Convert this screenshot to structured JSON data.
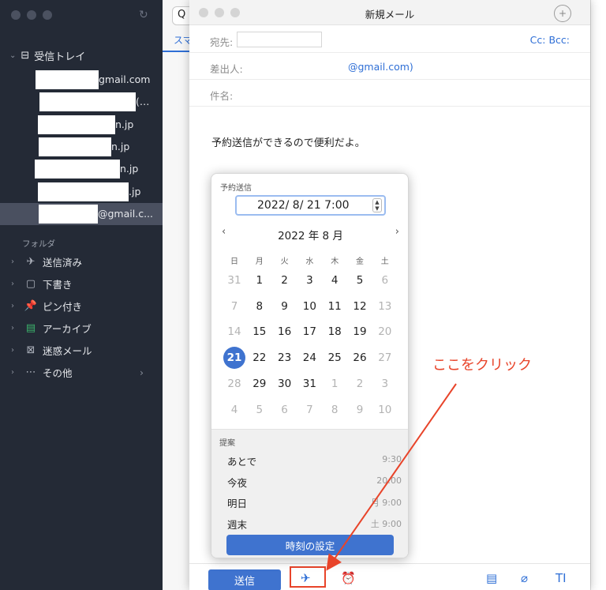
{
  "sidebar": {
    "inbox_label": "受信トレイ",
    "accounts": [
      {
        "text": "gmail.com",
        "mask_w": 80,
        "text_x": 125
      },
      {
        "text": "(…",
        "mask_w": 122,
        "text_x": 172
      },
      {
        "text": "n.jp",
        "mask_w": 98,
        "text_x": 146
      },
      {
        "text": "n.jp",
        "mask_w": 92,
        "text_x": 141
      },
      {
        "text": "n.jp",
        "mask_w": 108,
        "text_x": 152
      },
      {
        "text": ".jp",
        "mask_w": 115,
        "text_x": 163
      },
      {
        "text": "@gmail.c...",
        "mask_w": 75,
        "text_x": 124
      }
    ],
    "folders_title": "フォルダ",
    "folders": [
      {
        "label": "送信済み",
        "icon": "✈"
      },
      {
        "label": "下書き",
        "icon": "▢"
      },
      {
        "label": "ピン付き",
        "icon": "📌"
      },
      {
        "label": "アーカイブ",
        "icon": "▤"
      },
      {
        "label": "迷惑メール",
        "icon": "⊠"
      },
      {
        "label": "その他",
        "icon": "⋯"
      }
    ]
  },
  "list": {
    "search_icon": "Q",
    "tab_label": "スマ"
  },
  "compose": {
    "title": "新規メール",
    "to_label": "宛先:",
    "cc_bcc": "Cc:  Bcc:",
    "from_label": "差出人:",
    "from_value": "@gmail.com)",
    "subject_label": "件名:",
    "body": "予約送信ができるので便利だよ。",
    "send_label": "送信"
  },
  "schedule": {
    "title": "予約送信",
    "datetime": "2022/  8/ 21   7:00",
    "month_label": "2022 年 8 月",
    "prev": "‹",
    "next": "›",
    "weekdays": [
      "日",
      "月",
      "火",
      "水",
      "木",
      "金",
      "土"
    ],
    "weeks": [
      [
        "31",
        "1",
        "2",
        "3",
        "4",
        "5",
        "6"
      ],
      [
        "7",
        "8",
        "9",
        "10",
        "11",
        "12",
        "13"
      ],
      [
        "14",
        "15",
        "16",
        "17",
        "18",
        "19",
        "20"
      ],
      [
        "21",
        "22",
        "23",
        "24",
        "25",
        "26",
        "27"
      ],
      [
        "28",
        "29",
        "30",
        "31",
        "1",
        "2",
        "3"
      ],
      [
        "4",
        "5",
        "6",
        "7",
        "8",
        "9",
        "10"
      ]
    ],
    "dim_map": [
      [
        1,
        0,
        0,
        0,
        0,
        0,
        1
      ],
      [
        1,
        0,
        0,
        0,
        0,
        0,
        1
      ],
      [
        1,
        0,
        0,
        0,
        0,
        0,
        1
      ],
      [
        0,
        0,
        0,
        0,
        0,
        0,
        1
      ],
      [
        1,
        0,
        0,
        0,
        1,
        1,
        1
      ],
      [
        1,
        1,
        1,
        1,
        1,
        1,
        1
      ]
    ],
    "selected": "21",
    "suggest_title": "提案",
    "suggestions": [
      {
        "label": "あとで",
        "time": "9:30"
      },
      {
        "label": "今夜",
        "time": "20:00"
      },
      {
        "label": "明日",
        "time": "月 9:00"
      },
      {
        "label": "週末",
        "time": "土 9:00"
      }
    ],
    "set_time_label": "時刻の設定"
  },
  "annotation": {
    "text": "ここをクリック",
    "color": "#e8442a"
  }
}
